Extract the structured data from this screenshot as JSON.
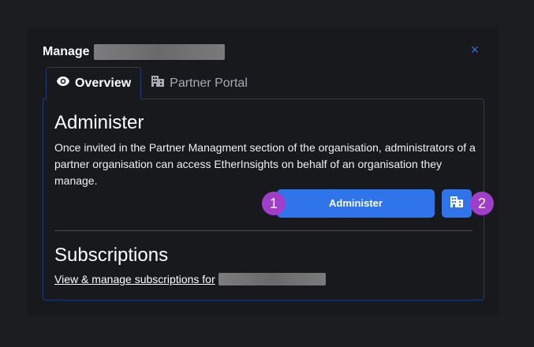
{
  "modal": {
    "title": "Manage",
    "close_glyph": "×"
  },
  "tabs": [
    {
      "label": "Overview",
      "icon": "eye-icon",
      "active": true
    },
    {
      "label": "Partner Portal",
      "icon": "building-icon",
      "active": false
    }
  ],
  "administer": {
    "heading": "Administer",
    "description": "Once invited in the Partner Managment section of the organisation, administrators of a partner organisation can access EtherInsights on behalf of an organisation they manage.",
    "button_label": "Administer",
    "portal_button_icon": "building-icon"
  },
  "badges": [
    "1",
    "2"
  ],
  "subscriptions": {
    "heading": "Subscriptions",
    "link_text": "View & manage subscriptions for"
  },
  "colors": {
    "accent": "#2f74e8",
    "badge": "#a03ec9",
    "border": "#1e3c78"
  }
}
